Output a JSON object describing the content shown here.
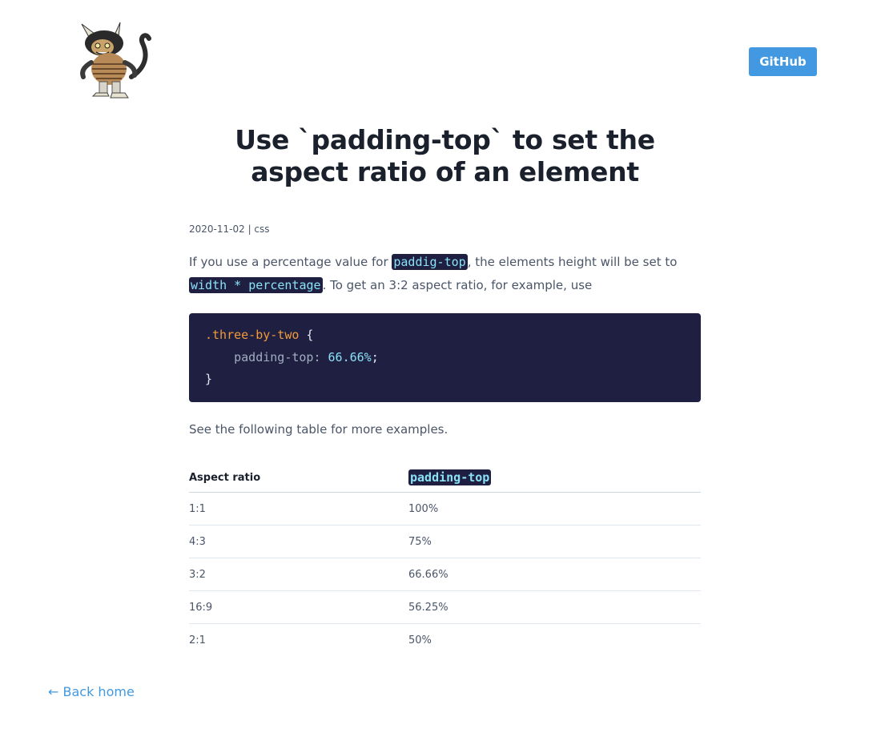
{
  "header": {
    "logo_icon": "wild-thing-monster-logo",
    "github_label": "GitHub"
  },
  "post": {
    "title": "Use `padding-top` to set the aspect ratio of an element",
    "date": "2020-11-02",
    "separator": " | ",
    "tag": "css",
    "intro": {
      "part1": "If you use a percentage value for ",
      "code1": "paddig-top",
      "part2": ", the elements height will be set to ",
      "code2": "width * percentage",
      "part3": ". To get an 3:2 aspect ratio, for example, use"
    },
    "code_block": {
      "selector": ".three-by-two",
      "open_brace": " {",
      "property": "padding-top",
      "colon": ": ",
      "value": "66.66%",
      "semicolon": ";",
      "close_brace": "}"
    },
    "after_code": "See the following table for more examples.",
    "table": {
      "headers": [
        "Aspect ratio",
        "padding-top"
      ],
      "rows": [
        [
          "1:1",
          "100%"
        ],
        [
          "4:3",
          "75%"
        ],
        [
          "3:2",
          "66.66%"
        ],
        [
          "16:9",
          "56.25%"
        ],
        [
          "2:1",
          "50%"
        ]
      ]
    }
  },
  "footer": {
    "back_label": "← Back home"
  },
  "colors": {
    "accent": "#4299e1",
    "code_bg": "#1f2041",
    "code_text": "#8ae2f7",
    "heading": "#1a202c"
  }
}
